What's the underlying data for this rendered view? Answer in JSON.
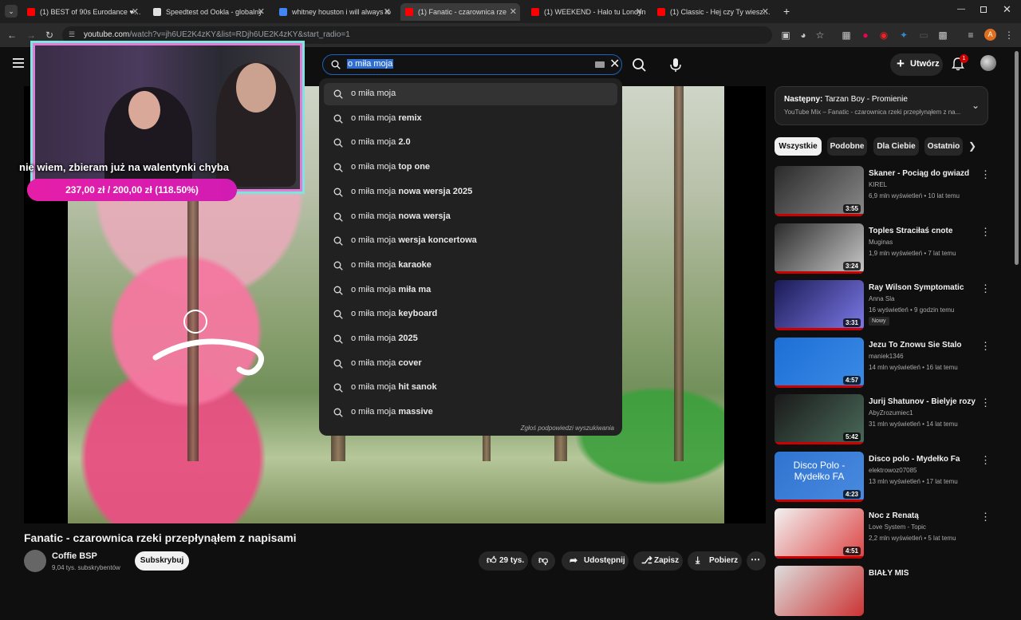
{
  "browser": {
    "tabs": [
      {
        "title": "(1) BEST of 90s Eurodance ♥ La",
        "fav": "#ff0000"
      },
      {
        "title": "Speedtest od Ookla - globalny",
        "fav": "#e0e0e0"
      },
      {
        "title": "whitney houston i will always lo",
        "fav": "#4285f4"
      },
      {
        "title": "(1) Fanatic - czarownica rze",
        "fav": "#ff0000"
      },
      {
        "title": "(1) WEEKEND - Halo tu Londyn",
        "fav": "#ff0000"
      },
      {
        "title": "(1) Classic - Hej czy Ty wiesz - Y",
        "fav": "#ff0000"
      }
    ],
    "url_domain": "youtube.com",
    "url_path": "/watch?v=jh6UE2K4zKY&list=RDjh6UE2K4zKY&start_radio=1",
    "profile_initial": "A"
  },
  "search": {
    "value": "o miła moja",
    "suggestion_prefix": "o miła moja",
    "suggestions": [
      "",
      "remix",
      "2.0",
      "top one",
      "nowa wersja 2025",
      "nowa wersja",
      "wersja koncertowa",
      "karaoke",
      "miła ma",
      "keyboard",
      "2025",
      "cover",
      "hit sanok",
      "massive"
    ],
    "report_label": "Zgłoś podpowiedzi wyszukiwania"
  },
  "header": {
    "create_label": "Utwórz",
    "notifications_count": "1"
  },
  "stream_overlay": {
    "text": "nie wiem, zbieram już na walentynki chyba",
    "donation": "237,00 zł / 200,00 zł (118.50%)",
    "donation_progress": 1.0
  },
  "video": {
    "title": "Fanatic - czarownica rzeki przepłynąłem z napisami",
    "channel": "Coffie BSP",
    "subscribers": "9,04 tys. subskrybentów",
    "subscribe_label": "Subskrybuj",
    "likes": "29 tys.",
    "share_label": "Udostępnij",
    "save_label": "Zapisz",
    "download_label": "Pobierz"
  },
  "up_next": {
    "label": "Następny:",
    "title": "Tarzan Boy - Promienie",
    "subtitle": "YouTube Mix – Fanatic - czarownica rzeki przepłynąłem z na..."
  },
  "chips": [
    "Wszystkie",
    "Podobne",
    "Dla Ciebie",
    "Ostatnio"
  ],
  "recommendations": [
    {
      "title": "Skaner - Pociąg do gwiazd",
      "channel": "KIREL",
      "meta": "6,9 mln wyświetleń • 10 lat temu",
      "duration": "3:55",
      "colors": [
        "#2a2a2a",
        "#8a8a8a"
      ]
    },
    {
      "title": "Toples Straciłaś cnote",
      "channel": "Muginas",
      "meta": "1,9 mln wyświetleń • 7 lat temu",
      "duration": "3:24",
      "colors": [
        "#2b2b2b",
        "#c9c9c9"
      ]
    },
    {
      "title": "Ray Wilson Symptomatic",
      "channel": "Anna Sla",
      "meta": "16 wyświetleń • 9 godzin temu",
      "duration": "3:31",
      "badge": "Nowy",
      "colors": [
        "#1a1a55",
        "#7d7ae8"
      ]
    },
    {
      "title": "Jezu To Znowu Sie Stalo",
      "channel": "maniek1346",
      "meta": "14 mln wyświetleń • 16 lat temu",
      "duration": "4:57",
      "colors": [
        "#1d6fd6",
        "#3b8ae6"
      ]
    },
    {
      "title": "Jurij Shatunov - Bielyje rozy",
      "channel": "AbyZrozumiec1",
      "meta": "31 mln wyświetleń • 14 lat temu",
      "duration": "5:42",
      "colors": [
        "#1a1a1a",
        "#4a6a5a"
      ]
    },
    {
      "title": "Disco polo - Mydełko Fa",
      "channel": "elektrowoz07085",
      "meta": "13 mln wyświetleń • 17 lat temu",
      "duration": "4:23",
      "colors": [
        "#2f74d0",
        "#4a8ae0"
      ],
      "thumb_text": "Disco Polo - Mydełko FA"
    },
    {
      "title": "Noc z Renatą",
      "channel": "Love System - Topic",
      "meta": "2,2 mln wyświetleń • 5 lat temu",
      "duration": "4:51",
      "colors": [
        "#f2f2f2",
        "#d44"
      ]
    },
    {
      "title": "BIAŁY MIŚ",
      "channel": "",
      "meta": "",
      "duration": "",
      "colors": [
        "#ddd",
        "#c33"
      ]
    }
  ]
}
